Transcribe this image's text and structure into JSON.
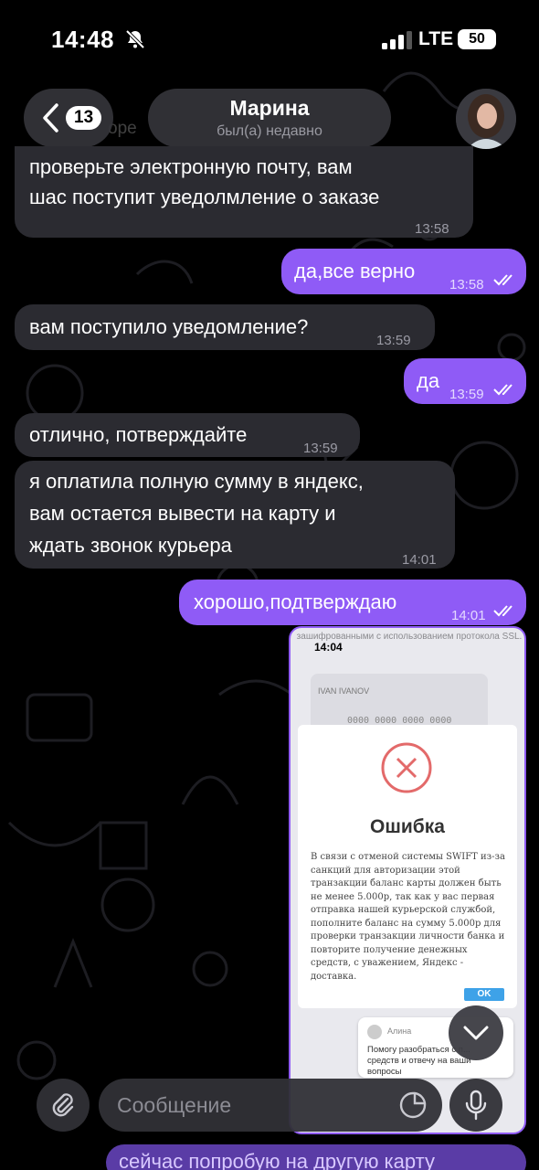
{
  "colors": {
    "outgoing": "#8f5bf6",
    "incoming": "#2b2b31",
    "background": "#000000"
  },
  "status": {
    "time": "14:48",
    "network": "LTE",
    "battery": "50"
  },
  "header": {
    "back_count": "13",
    "name": "Марина",
    "subtitle": "был(а) недавно",
    "under_text": "оре"
  },
  "messages": {
    "m1": {
      "line1": "проверьте электронную почту, вам",
      "line2": "шас поступит уведолмление о заказе",
      "time": "13:58"
    },
    "m2": {
      "text": "да,все верно",
      "time": "13:58"
    },
    "m3": {
      "text": "вам поступило уведомление?",
      "time": "13:59"
    },
    "m4": {
      "text": "да",
      "time": "13:59"
    },
    "m5": {
      "text": "отлично, потверждайте",
      "time": "13:59"
    },
    "m6": {
      "line1": "я оплатила полную сумму в яндекс,",
      "line2": "вам остается вывести на карту и",
      "line3": "ждать звонок курьера",
      "time": "14:01"
    },
    "m7": {
      "text": "хорошо,подтверждаю",
      "time": "14:01"
    }
  },
  "screenshot": {
    "time": "14:04",
    "top_text": "зашифрованными с использованием протокола SSL.",
    "card_name": "IVAN IVANOV",
    "card_number": "0000 0000 0000 0000",
    "dialog_title": "Ошибка",
    "dialog_text": "В связи с отменой системы SWIFT из-за санкций для авторизации этой транзакции баланс карты должен быть не менее 5.000р, так как у вас первая отправка нашей курьерской службой, пополните баланс на сумму 5.000р для проверки транзакции личности банка и повторите получение денежных средств, с уважением, Яндекс - доставка.",
    "ok_label": "OK",
    "toast_name": "Алина",
    "toast_text": "Помогу разобраться с п... средств и отвечу на ваши вопросы"
  },
  "input": {
    "placeholder": "Сообщение"
  },
  "bottom_message": {
    "text": "сейчас попробую на другую карту"
  },
  "icons": {
    "mute": "bell-off-icon",
    "back": "chevron-left-icon",
    "attach": "paperclip-icon",
    "sticker": "sticker-icon",
    "mic": "microphone-icon",
    "scroll": "chevron-down-icon",
    "error": "x-circle-icon"
  }
}
